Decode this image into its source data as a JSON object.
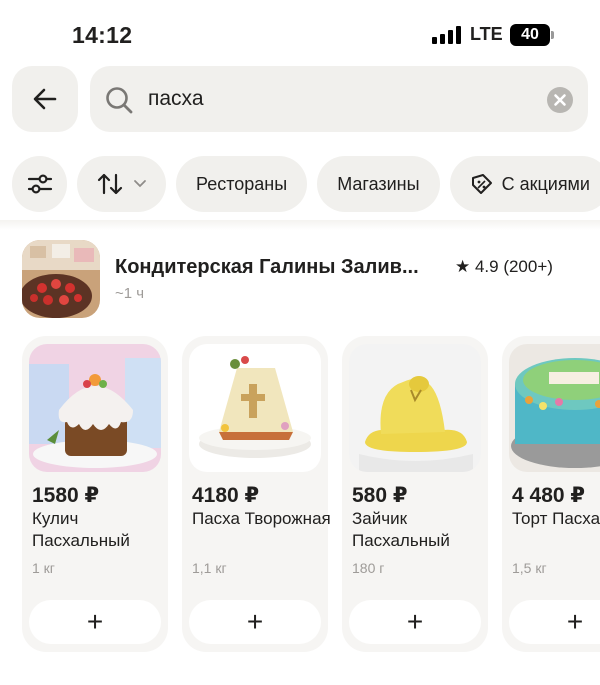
{
  "status_bar": {
    "time": "14:12",
    "network": "LTE",
    "battery": "40"
  },
  "search": {
    "value": "пасха"
  },
  "filters": [
    {
      "label": "",
      "icon": "filter-sliders-icon"
    },
    {
      "label": "",
      "icon": "sort-arrows-icon"
    },
    {
      "label": "Рестораны"
    },
    {
      "label": "Магазины"
    },
    {
      "label": "С акциями",
      "icon": "discount-tag-icon"
    }
  ],
  "store": {
    "name": "Кондитерская Галины Залив...",
    "rating": "★ 4.9 (200+)",
    "eta": "~1 ч"
  },
  "products": [
    {
      "price": "1580 ₽",
      "name": "Кулич Пасхальный",
      "weight": "1 кг",
      "add": "+"
    },
    {
      "price": "4180 ₽",
      "name": "Пасха Творожная",
      "weight": "1,1 кг",
      "add": "+"
    },
    {
      "price": "580 ₽",
      "name": "Зайчик Пасхальный",
      "weight": "180 г",
      "add": "+"
    },
    {
      "price": "4 480 ₽",
      "name": "Торт Пасхальный",
      "weight": "1,5 кг",
      "add": "+"
    }
  ],
  "colors": {
    "surface": "#f1f0ed",
    "card": "#f6f5f3",
    "text": "#21201f",
    "muted": "#9e9b98"
  }
}
